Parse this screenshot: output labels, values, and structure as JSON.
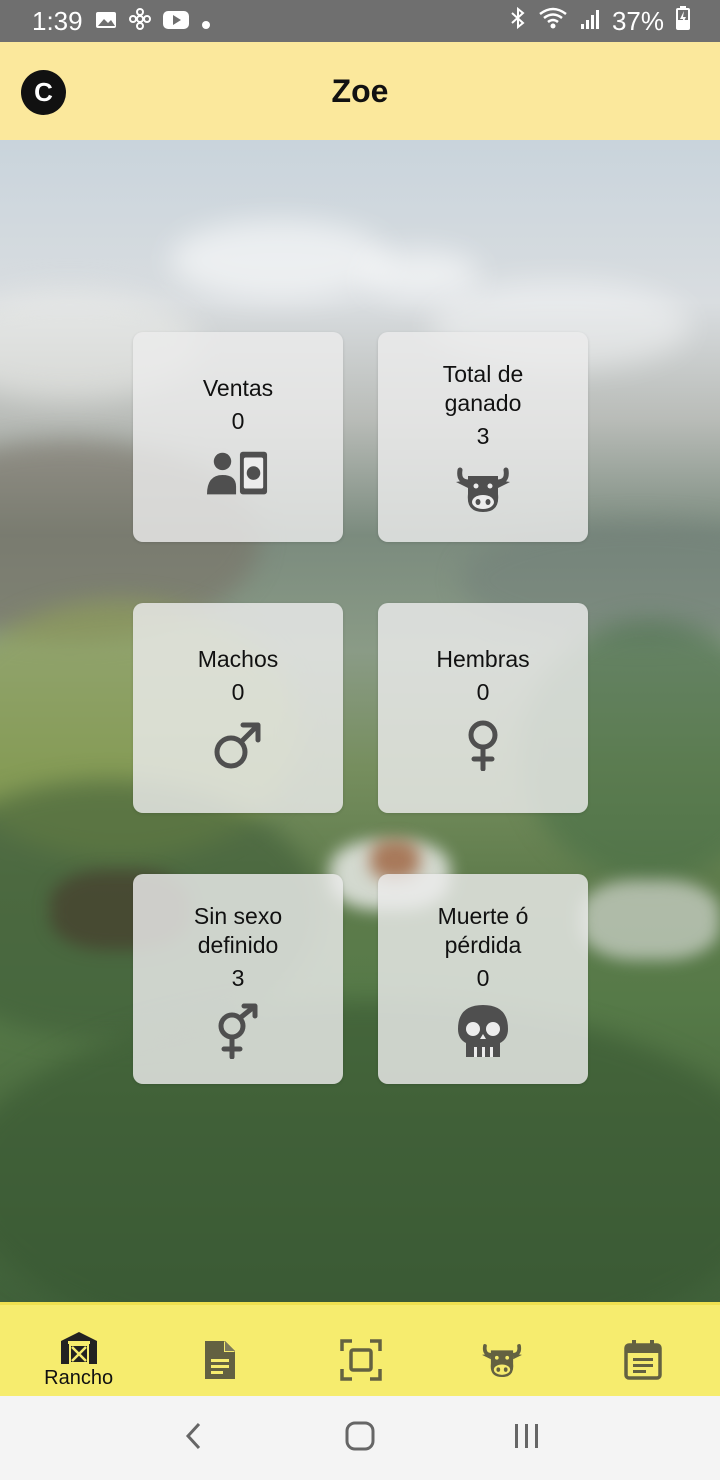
{
  "status_bar": {
    "time": "1:39",
    "battery": "37%",
    "icons": [
      "image-icon",
      "pinwheel-icon",
      "youtube-icon",
      "dot-icon",
      "bluetooth-icon",
      "wifi-icon",
      "signal-icon",
      "battery-charging-icon"
    ]
  },
  "app_bar": {
    "logo_letter": "C",
    "title": "Zoe"
  },
  "cards": [
    {
      "label": "Ventas",
      "value": "0",
      "icon": "sales-icon"
    },
    {
      "label": "Total de ganado",
      "value": "3",
      "icon": "cow-icon"
    },
    {
      "label": "Machos",
      "value": "0",
      "icon": "male-icon"
    },
    {
      "label": "Hembras",
      "value": "0",
      "icon": "female-icon"
    },
    {
      "label": "Sin sexo definido",
      "value": "3",
      "icon": "intersex-icon"
    },
    {
      "label": "Muerte ó pérdida",
      "value": "0",
      "icon": "skull-icon"
    }
  ],
  "bottom_nav": {
    "items": [
      {
        "label": "Rancho",
        "icon": "barn-icon",
        "active": true
      },
      {
        "label": "",
        "icon": "document-icon",
        "active": false
      },
      {
        "label": "",
        "icon": "scan-icon",
        "active": false
      },
      {
        "label": "",
        "icon": "cow-icon",
        "active": false
      },
      {
        "label": "",
        "icon": "calendar-icon",
        "active": false
      }
    ]
  },
  "system_nav": [
    "back-icon",
    "home-icon",
    "recents-icon"
  ],
  "colors": {
    "app_bar": "#fbe89c",
    "bottom_nav": "#f6ec6e",
    "icon_gray": "#4f4f4f",
    "status_bar": "#6f6f6f"
  }
}
